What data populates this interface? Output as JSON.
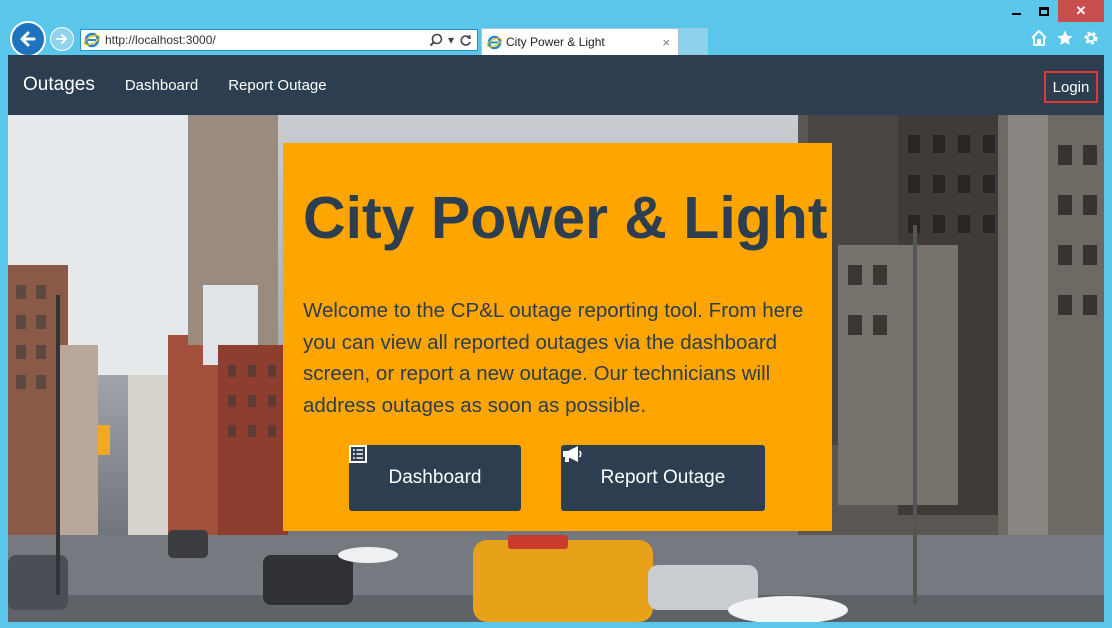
{
  "browser": {
    "address_url": "http://localhost:3000/",
    "tab_title": "City Power & Light",
    "tab_close": "×",
    "icons": [
      "back-icon",
      "forward-icon",
      "ie-icon",
      "search-icon",
      "refresh-icon",
      "home-icon",
      "favorites-star-icon",
      "settings-gear-icon"
    ]
  },
  "navbar": {
    "brand": "Outages",
    "links": [
      "Dashboard",
      "Report Outage"
    ],
    "login": "Login"
  },
  "hero": {
    "title": "City Power & Light",
    "description": "Welcome to the CP&L outage reporting tool. From here you can view all reported outages via the dashboard screen, or report a new outage. Our technicians will address outages as soon as possible.",
    "buttons": {
      "dashboard": "Dashboard",
      "report": "Report Outage"
    }
  },
  "colors": {
    "navbar_bg": "#2c3e50",
    "card_bg": "#ffa500",
    "login_border": "#e03c2b",
    "chrome_bg": "#5ac7ea"
  }
}
